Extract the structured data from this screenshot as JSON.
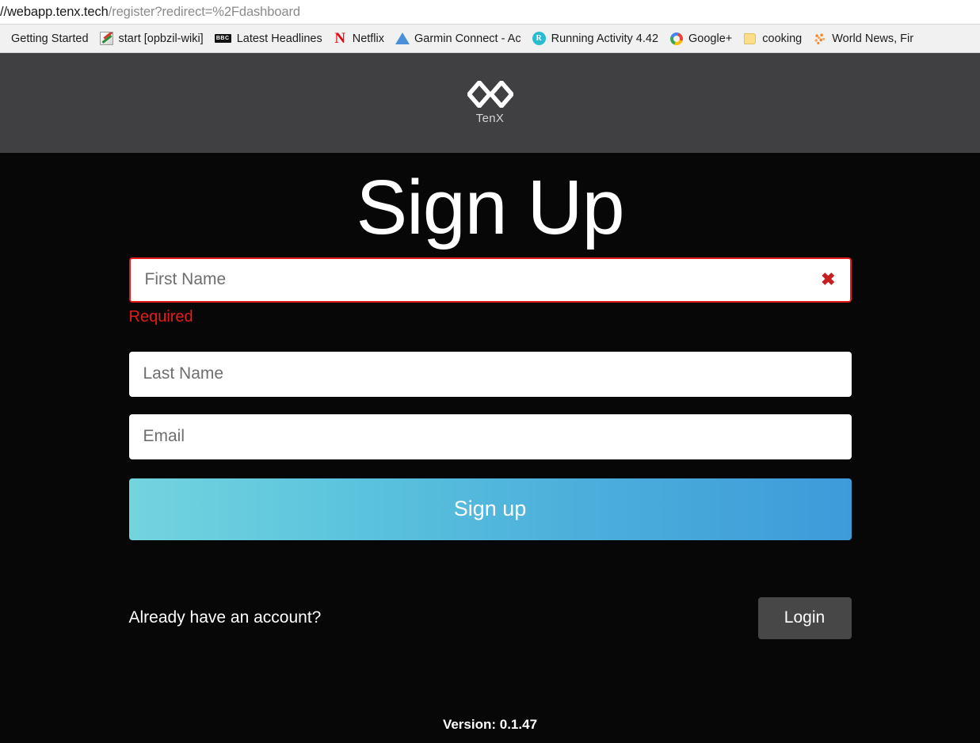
{
  "browser": {
    "url": {
      "host_part": "//webapp.tenx.tech",
      "path_part": "/register?redirect=%2Fdashboard"
    },
    "bookmarks": [
      {
        "label": "Getting Started",
        "icon": "none"
      },
      {
        "label": "start [opbzil-wiki]",
        "icon": "pencil-notepad-icon"
      },
      {
        "label": "Latest Headlines",
        "icon": "bbc-icon"
      },
      {
        "label": "Netflix",
        "icon": "netflix-icon"
      },
      {
        "label": "Garmin Connect - Ac",
        "icon": "garmin-triangle-icon"
      },
      {
        "label": "Running Activity 4.42",
        "icon": "running-circle-icon"
      },
      {
        "label": "Google+",
        "icon": "google-icon"
      },
      {
        "label": "cooking",
        "icon": "folder-icon"
      },
      {
        "label": "World News, Fir",
        "icon": "orange-dots-icon"
      }
    ]
  },
  "header": {
    "logo_text": "TenX",
    "background_color": "#404043"
  },
  "main": {
    "title": "Sign Up",
    "fields": [
      {
        "name": "first-name",
        "placeholder": "First Name",
        "value": "",
        "error": "Required",
        "has_error": true
      },
      {
        "name": "last-name",
        "placeholder": "Last Name",
        "value": "",
        "error": "",
        "has_error": false
      },
      {
        "name": "email",
        "placeholder": "Email",
        "value": "",
        "error": "",
        "has_error": false
      }
    ],
    "signup_label": "Sign up",
    "account_prompt": "Already have an account?",
    "login_label": "Login",
    "version": "Version: 0.1.47"
  },
  "colors": {
    "error_red": "#e41c1c",
    "gradient_start": "#73d4de",
    "gradient_end": "#3d9bda",
    "page_background": "#070707",
    "login_button": "#474747"
  }
}
